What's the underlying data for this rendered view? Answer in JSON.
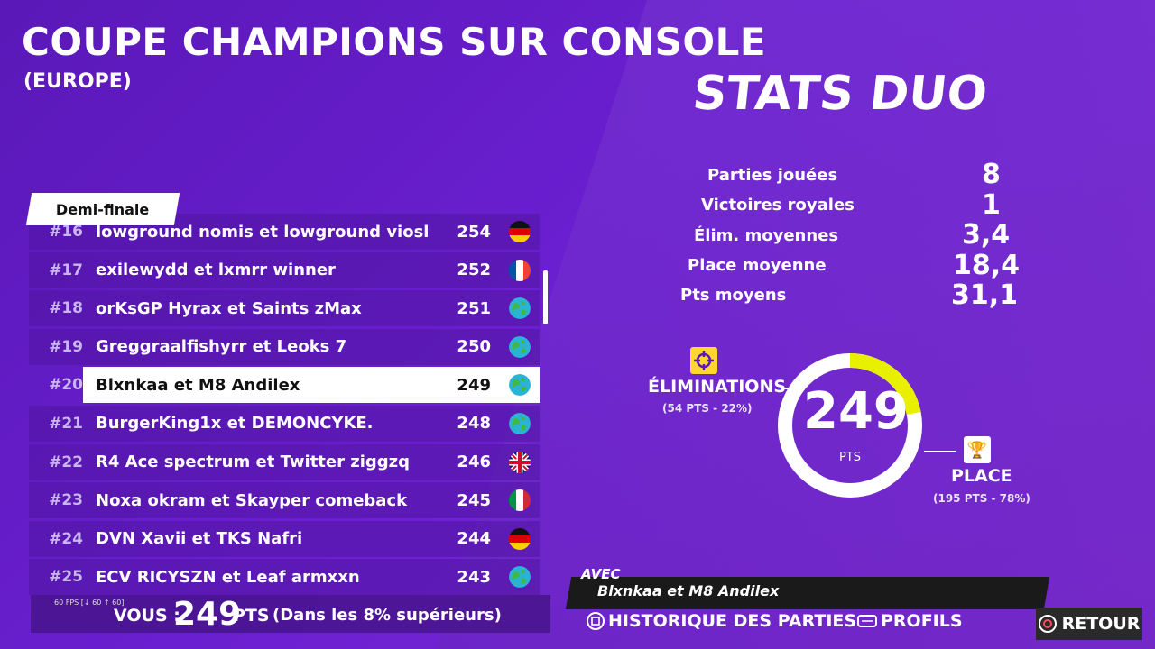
{
  "header": {
    "title": "COUPE CHAMPIONS SUR CONSOLE",
    "subtitle": "(EUROPE)"
  },
  "stats_title": "STATS DUO",
  "leaderboard": {
    "tab": "Demi-finale",
    "rows": [
      {
        "rank": "#16",
        "names": "lowground nomis et lowground viosk",
        "score": "254",
        "flag": "germany-flag"
      },
      {
        "rank": "#17",
        "names": "exilewydd et lxmrr winner",
        "score": "252",
        "flag": "france-flag"
      },
      {
        "rank": "#18",
        "names": "orKsGP Hyrax et Saints zMax",
        "score": "251",
        "flag": "globe-icon"
      },
      {
        "rank": "#19",
        "names": "Greggraalfishyrr et Leoks 7",
        "score": "250",
        "flag": "globe-icon"
      },
      {
        "rank": "#20",
        "names": "Blxnkaa et M8 Andilex",
        "score": "249",
        "flag": "globe-icon",
        "highlight": true
      },
      {
        "rank": "#21",
        "names": "BurgerKing1x et DEMONCYKE.",
        "score": "248",
        "flag": "globe-icon"
      },
      {
        "rank": "#22",
        "names": "R4 Ace spectrum et Twitter ziggzq",
        "score": "246",
        "flag": "uk-flag"
      },
      {
        "rank": "#23",
        "names": "Noxa okram et Skayper comeback",
        "score": "245",
        "flag": "italy-flag"
      },
      {
        "rank": "#24",
        "names": "DVN Xavii et TKS Nafri",
        "score": "244",
        "flag": "germany-flag"
      },
      {
        "rank": "#25",
        "names": "ECV RICYSZN et Leaf armxxn",
        "score": "243",
        "flag": "globe-icon"
      }
    ]
  },
  "you": {
    "label": "VOUS :",
    "points": "249",
    "unit": "PTS",
    "percentile": "(Dans les 8% supérieurs)",
    "fps": "60 FPS [↓ 60 ↑ 60]"
  },
  "stats": [
    {
      "label": "Parties jouées",
      "value": "8"
    },
    {
      "label": "Victoires royales",
      "value": "1"
    },
    {
      "label": "Élim. moyennes",
      "value": "3,4"
    },
    {
      "label": "Place moyenne",
      "value": "18,4"
    },
    {
      "label": "Pts moyens",
      "value": "31,1"
    }
  ],
  "donut": {
    "total": "249",
    "unit": "PTS",
    "elim_fraction": 0.22,
    "elim_color": "#e8f000",
    "place_color": "#ffffff"
  },
  "eliminations": {
    "label": "ÉLIMINATIONS",
    "detail": "(54 PTS - 22%)"
  },
  "place": {
    "label": "PLACE",
    "detail": "(195 PTS - 78%)"
  },
  "avec": {
    "label": "AVEC",
    "names": "Blxnkaa et M8 Andilex"
  },
  "bottom": {
    "history": "HISTORIQUE DES PARTIES",
    "profiles": "PROFILS",
    "back": "RETOUR"
  }
}
